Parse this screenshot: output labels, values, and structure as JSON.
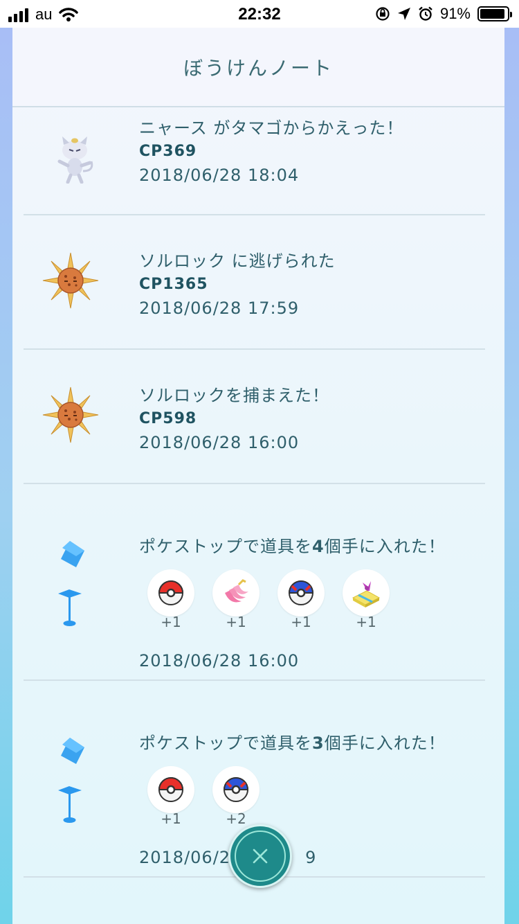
{
  "status_bar": {
    "carrier": "au",
    "time": "22:32",
    "battery_percent": "91%",
    "battery_level": 0.91
  },
  "header": {
    "title": "ぼうけんノート"
  },
  "entries": [
    {
      "title": "ニャース がタマゴからかえった！",
      "cp": "CP369",
      "date": "2018/06/28 18:04",
      "icon": "meowth-alolan-icon"
    },
    {
      "title": "ソルロック に逃げられた",
      "cp": "CP1365",
      "date": "2018/06/28 17:59",
      "icon": "solrock-icon"
    },
    {
      "title": "ソルロックを捕まえた！",
      "cp": "CP598",
      "date": "2018/06/28 16:00",
      "icon": "solrock-icon"
    },
    {
      "title_prefix": "ポケストップで道具を",
      "title_count": "4",
      "title_suffix": "個手に入れた！",
      "date": "2018/06/28 16:00",
      "icon": "pokestop-icon",
      "items": [
        {
          "icon": "poke-ball-icon",
          "count": "+1"
        },
        {
          "icon": "nanab-berry-icon",
          "count": "+1"
        },
        {
          "icon": "great-ball-icon",
          "count": "+1"
        },
        {
          "icon": "gift-icon",
          "count": "+1"
        }
      ]
    },
    {
      "title_prefix": "ポケストップで道具を",
      "title_count": "3",
      "title_suffix": "個手に入れた！",
      "date": "2018/06/2",
      "date_tail": "9",
      "icon": "pokestop-icon",
      "items": [
        {
          "icon": "poke-ball-icon",
          "count": "+1"
        },
        {
          "icon": "great-ball-icon",
          "count": "+2"
        }
      ]
    }
  ],
  "close_button": {
    "icon": "close-icon"
  }
}
